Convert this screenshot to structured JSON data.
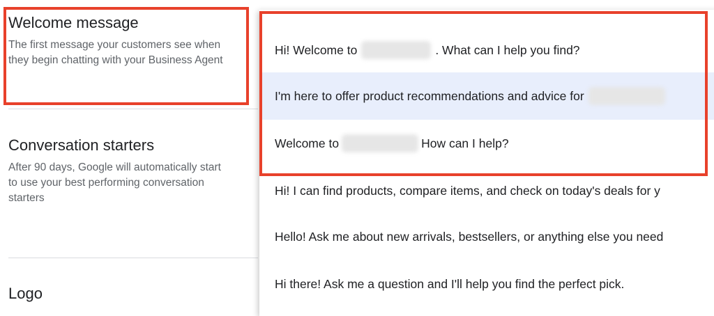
{
  "welcome": {
    "title": "Welcome message",
    "description": "The first message your customers see when they begin chatting with your Business Agent"
  },
  "starters": {
    "title": "Conversation starters",
    "description": "After 90 days, Google will automatically start to use your best performing conversation starters"
  },
  "logo": {
    "title": "Logo"
  },
  "options": [
    {
      "before": "Hi! Welcome to",
      "after": ". What can I help you find?"
    },
    {
      "before": "I'm here to offer product recommendations and advice for",
      "after": ""
    },
    {
      "before": "Welcome to",
      "after": " How can I help?"
    },
    {
      "before": "Hi! I can find products, compare items, and check on today's deals for y",
      "after": ""
    },
    {
      "before": "Hello! Ask me about new arrivals, bestsellers, or anything else you need",
      "after": ""
    },
    {
      "before": "Hi there! Ask me a question and I'll help you find the perfect pick.",
      "after": ""
    }
  ],
  "colors": {
    "annotation": "#e8412b",
    "selected_bg": "#e8eefc"
  }
}
